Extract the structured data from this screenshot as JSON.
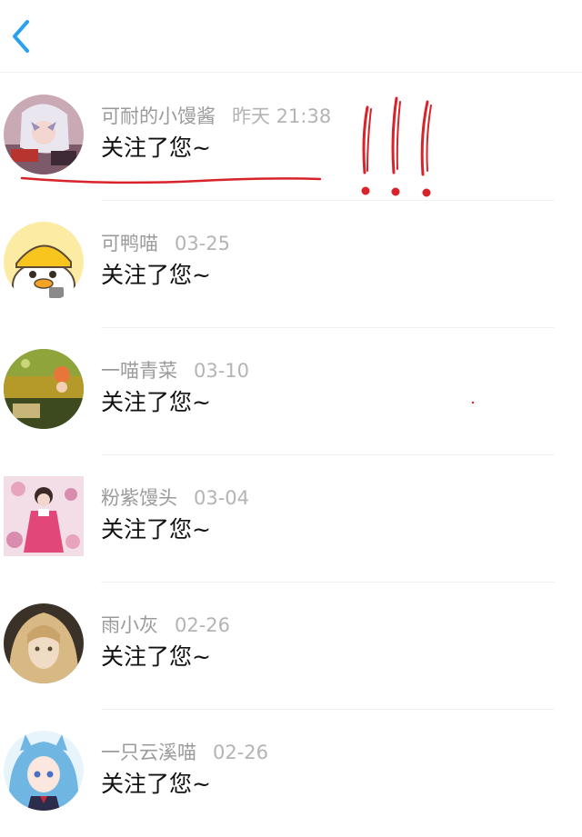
{
  "header": {
    "back_icon": "chevron-left-icon",
    "accent_color": "#2aa1f0"
  },
  "notifications": [
    {
      "name": "可耐的小馒酱",
      "time": "昨天 21:38",
      "message": "关注了您~",
      "avatar": "anime-girl-white-hair"
    },
    {
      "name": "可鸭喵",
      "time": "03-25",
      "message": "关注了您~",
      "avatar": "yellow-duck-cartoon"
    },
    {
      "name": "一喵青菜",
      "time": "03-10",
      "message": "关注了您~",
      "avatar": "forest-scene"
    },
    {
      "name": "粉紫馒头",
      "time": "03-04",
      "message": "关注了您~",
      "avatar": "pink-dress-girl"
    },
    {
      "name": "雨小灰",
      "time": "02-26",
      "message": "关注了您~",
      "avatar": "blonde-hair-portrait"
    },
    {
      "name": "一只云溪喵",
      "time": "02-26",
      "message": "关注了您~",
      "avatar": "blue-hair-catgirl"
    }
  ],
  "annotation": {
    "color": "#d8232a",
    "marks": "!!!"
  }
}
